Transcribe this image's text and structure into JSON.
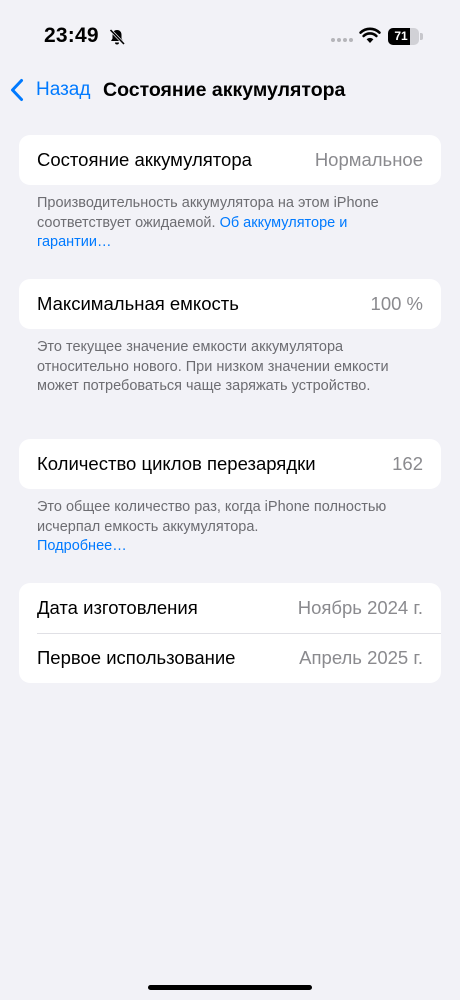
{
  "status_bar": {
    "time": "23:49",
    "battery_level": "71",
    "battery_fraction": 0.71,
    "icons": [
      "bell-slash-icon",
      "cellular-signal-icon",
      "wifi-icon",
      "battery-icon"
    ]
  },
  "nav": {
    "back_label": "Назад",
    "title": "Состояние аккумулятора"
  },
  "health": {
    "label": "Состояние аккумулятора",
    "value": "Нормальное",
    "footer_text": "Производительность аккумулятора на этом iPhone соответствует ожидаемой. ",
    "footer_link": "Об аккумуляторе и гарантии…"
  },
  "capacity": {
    "label": "Максимальная емкость",
    "value": "100 %",
    "footer_text": "Это текущее значение емкости аккумулятора относительно нового. При низком значении емкости может потребоваться чаще заряжать устройство."
  },
  "cycles": {
    "label": "Количество циклов перезарядки",
    "value": "162",
    "footer_text": "Это общее количество раз, когда iPhone полностью исчерпал емкость аккумулятора.",
    "footer_link": "Подробнее…"
  },
  "dates": {
    "manufacture_label": "Дата изготовления",
    "manufacture_value": "Ноябрь 2024 г.",
    "first_use_label": "Первое использование",
    "first_use_value": "Апрель 2025 г."
  },
  "colors": {
    "background": "#f2f2f7",
    "accent": "#007aff",
    "secondary_text": "#8a8a8e"
  }
}
